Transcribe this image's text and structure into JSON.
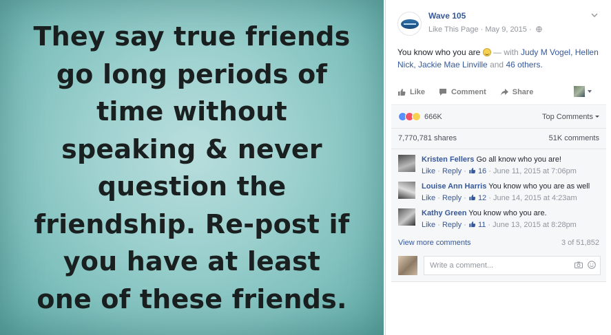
{
  "image_post": {
    "quote_lines": [
      "They say true friends",
      "go long periods of",
      "time without",
      "speaking & never",
      "question the",
      "friendship. Re-post if",
      "you have at least",
      "one of these friends."
    ]
  },
  "post": {
    "page_name": "Wave 105",
    "like_page_label": "Like This Page",
    "separator": "·",
    "date": "May 9, 2015",
    "message_text": "You know who you are",
    "with_label": "— with",
    "tagged": "Judy M Vogel, Hellen Nick, Jackie Mae Linville",
    "and_label": "and",
    "others_label": "46 others."
  },
  "actions": {
    "like": "Like",
    "comment": "Comment",
    "share": "Share"
  },
  "feedback": {
    "reaction_count": "666K",
    "sort_label": "Top Comments",
    "shares_label": "7,770,781 shares",
    "comments_label": "51K comments",
    "view_more_label": "View more comments",
    "pagination_label": "3 of 51,852",
    "write_placeholder": "Write a comment..."
  },
  "comments": [
    {
      "author": "Kristen Fellers",
      "text": "Go all know who you are!",
      "like": "Like",
      "reply": "Reply",
      "likes": "16",
      "date": "June 11, 2015 at 7:06pm"
    },
    {
      "author": "Louise Ann Harris",
      "text": "You know who you are as well",
      "like": "Like",
      "reply": "Reply",
      "likes": "12",
      "date": "June 14, 2015 at 4:23am"
    },
    {
      "author": "Kathy Green",
      "text": "You know who you are.",
      "like": "Like",
      "reply": "Reply",
      "likes": "11",
      "date": "June 13, 2015 at 8:28pm"
    }
  ],
  "colors": {
    "link": "#365899",
    "muted": "#90949c",
    "text": "#1d2129",
    "image_teal": "#9fd2d0"
  },
  "icons": [
    "globe-icon",
    "chevron-down-icon",
    "like-icon",
    "comment-icon",
    "share-icon",
    "thumbs-up-icon",
    "camera-icon",
    "emoji-icon"
  ]
}
